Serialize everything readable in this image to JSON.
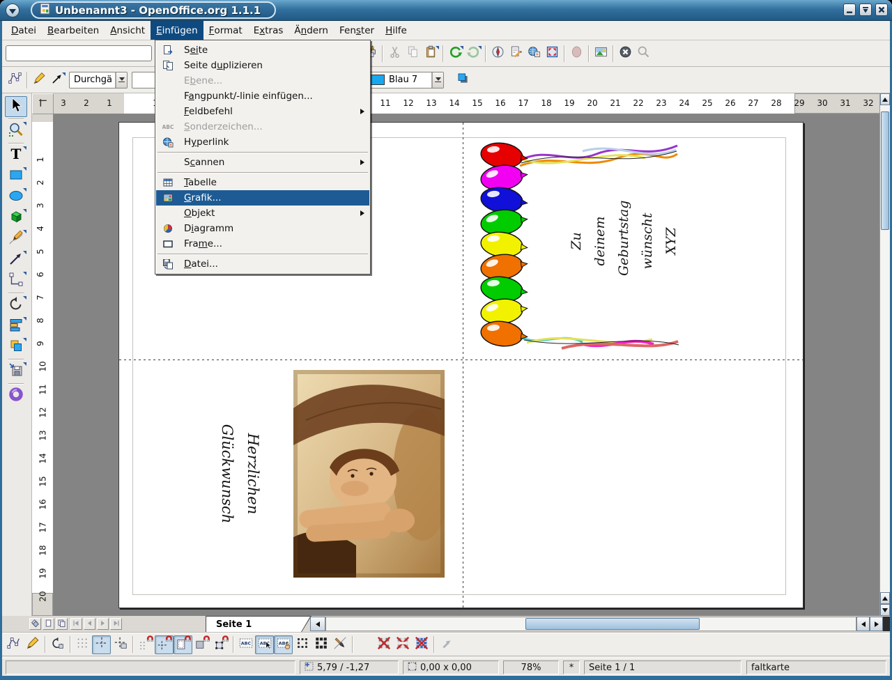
{
  "window": {
    "title": "Unbenannt3 - OpenOffice.org 1.1.1"
  },
  "menubar": {
    "items": [
      {
        "label": "Datei",
        "ul": "D"
      },
      {
        "label": "Bearbeiten",
        "ul": "B"
      },
      {
        "label": "Ansicht",
        "ul": "A"
      },
      {
        "label": "Einfügen",
        "ul": "E",
        "active": true
      },
      {
        "label": "Format",
        "ul": "F"
      },
      {
        "label": "Extras",
        "ul": "x"
      },
      {
        "label": "Ändern",
        "ul": "n"
      },
      {
        "label": "Fenster",
        "ul": "s"
      },
      {
        "label": "Hilfe",
        "ul": "H"
      }
    ]
  },
  "insert_menu": {
    "items": [
      {
        "label": "Seite",
        "ul": "ei",
        "icon": "m_pageins",
        "icon_name": "insert-page-icon"
      },
      {
        "label": "Seite duplizieren",
        "ul": "u",
        "icon": "m_pagedup",
        "icon_name": "duplicate-page-icon"
      },
      {
        "label": "Ebene...",
        "ul": "b",
        "disabled": true
      },
      {
        "label": "Fangpunkt/-linie einfügen...",
        "ul": "a"
      },
      {
        "label": "Feldbefehl",
        "ul": "F",
        "submenu": true
      },
      {
        "label": "Sonderzeichen...",
        "ul": "S",
        "icon": "m_abc",
        "icon_name": "special-character-icon",
        "disabled": true
      },
      {
        "label": "Hyperlink",
        "ul": "y",
        "icon": "m_hyper",
        "icon_name": "hyperlink-icon"
      },
      {
        "sep": true
      },
      {
        "label": "Scannen",
        "ul": "c",
        "submenu": true
      },
      {
        "sep": true
      },
      {
        "label": "Tabelle",
        "ul": "T",
        "icon": "m_table",
        "icon_name": "table-icon"
      },
      {
        "label": "Grafik...",
        "ul": "G",
        "icon": "m_graphic",
        "icon_name": "graphic-icon",
        "highlighted": true
      },
      {
        "label": "Objekt",
        "ul": "O",
        "submenu": true
      },
      {
        "label": "Diagramm",
        "ul": "i",
        "icon": "m_chart",
        "icon_name": "chart-icon"
      },
      {
        "label": "Frame...",
        "ul": "m",
        "icon": "m_frame",
        "icon_name": "frame-icon"
      },
      {
        "sep": true
      },
      {
        "label": "Datei...",
        "ul": "D",
        "icon": "m_file",
        "icon_name": "file-icon"
      }
    ]
  },
  "function_bar": {
    "url_value": "",
    "buttons": [
      {
        "name": "print-file-direct",
        "icon": "printer",
        "icon_name": "printer-icon"
      },
      {
        "sep": true
      },
      {
        "name": "cut",
        "icon": "cut",
        "icon_name": "scissors-icon",
        "disabled": true
      },
      {
        "name": "copy",
        "icon": "copy",
        "icon_name": "copy-icon",
        "disabled": true
      },
      {
        "name": "paste",
        "icon": "paste",
        "icon_name": "clipboard-icon",
        "dd": true
      },
      {
        "sep": true
      },
      {
        "name": "undo",
        "icon": "undo",
        "icon_name": "undo-icon",
        "dd": true
      },
      {
        "name": "restore",
        "icon": "redo",
        "icon_name": "redo-icon",
        "disabled": true,
        "dd": true
      },
      {
        "sep": true
      },
      {
        "name": "navigator",
        "icon": "navigator",
        "icon_name": "navigator-compass-icon"
      },
      {
        "name": "stylist",
        "icon": "stylist",
        "icon_name": "stylist-icon"
      },
      {
        "name": "hyperlink-bar",
        "icon": "hyperbar",
        "icon_name": "globe-document-icon"
      },
      {
        "name": "zoom",
        "icon": "zoomfit",
        "icon_name": "zoom-arrows-icon"
      },
      {
        "sep": true
      },
      {
        "name": "edit-mode",
        "icon": "editmode",
        "icon_name": "oval-icon",
        "disabled": true
      },
      {
        "sep": true
      },
      {
        "name": "gallery",
        "icon": "gallery",
        "icon_name": "gallery-image-icon"
      },
      {
        "sep": true
      },
      {
        "name": "stop-loading",
        "icon": "stop",
        "icon_name": "stop-icon"
      },
      {
        "name": "search",
        "icon": "search",
        "icon_name": "search-icon",
        "disabled": true
      }
    ]
  },
  "object_bar": {
    "line_style": "Durchgä",
    "line_width": "",
    "fill_color_name": "Blau 7",
    "fill_color_hex": "#18a8f0"
  },
  "left_toolbar": {
    "tools": [
      {
        "name": "select",
        "icon": "sel",
        "icon_name": "select-arrow-icon",
        "pressed": true
      },
      {
        "sep": true
      },
      {
        "name": "zoom",
        "icon": "zoomtool",
        "icon_name": "magnifier-icon",
        "dd": true
      },
      {
        "sep": true
      },
      {
        "name": "text",
        "icon": "texttool",
        "icon_name": "text-icon",
        "dd": true
      },
      {
        "name": "rectangle",
        "icon": "recttool",
        "icon_name": "rectangle-icon",
        "dd": true
      },
      {
        "name": "ellipse",
        "icon": "ellipsetool",
        "icon_name": "ellipse-icon",
        "dd": true
      },
      {
        "name": "3d-objects",
        "icon": "cube3d",
        "icon_name": "cube-icon",
        "dd": true
      },
      {
        "name": "curve",
        "icon": "curvetool",
        "icon_name": "pencil-curve-icon",
        "dd": true
      },
      {
        "name": "lines-arrows",
        "icon": "linetool",
        "icon_name": "arrow-line-icon",
        "dd": true
      },
      {
        "name": "connector",
        "icon": "connector",
        "icon_name": "connector-icon",
        "dd": true
      },
      {
        "sep": true
      },
      {
        "name": "rotate",
        "icon": "rotatetool",
        "icon_name": "rotate-icon",
        "dd": true
      },
      {
        "name": "alignment",
        "icon": "aligntool",
        "icon_name": "alignment-icon",
        "dd": true
      },
      {
        "name": "arrange",
        "icon": "arrangetool",
        "icon_name": "arrange-icon",
        "dd": true
      },
      {
        "sep": true
      },
      {
        "name": "insert-object",
        "icon": "insertobj",
        "icon_name": "insert-object-icon",
        "dd": true
      },
      {
        "sep": true
      },
      {
        "name": "effects",
        "icon": "donut",
        "icon_name": "torus-icon"
      }
    ]
  },
  "options_bar": {
    "buttons": [
      {
        "name": "edit-points-mode",
        "icon": "o_editpoints",
        "icon_name": "edit-points-icon"
      },
      {
        "name": "edit-line",
        "icon": "o_pen",
        "icon_name": "pen-icon"
      },
      {
        "sep": true
      },
      {
        "name": "rotation-mode",
        "icon": "o_rotmode",
        "icon_name": "rotation-mode-icon"
      },
      {
        "sep": true
      },
      {
        "name": "show-grid",
        "icon": "o_grid",
        "icon_name": "grid-icon"
      },
      {
        "name": "show-guides",
        "icon": "o_guides",
        "icon_name": "guides-icon",
        "pressed": true
      },
      {
        "name": "guides-to-front",
        "icon": "o_guidesfront",
        "icon_name": "guides-front-icon"
      },
      {
        "sep": true
      },
      {
        "name": "snap-to-grid",
        "icon": "o_snapgrid",
        "icon_name": "snap-grid-icon"
      },
      {
        "name": "snap-to-guides",
        "icon": "o_snapguides",
        "icon_name": "snap-guides-icon",
        "pressed": true
      },
      {
        "name": "snap-to-page-margins",
        "icon": "o_snapmargin",
        "icon_name": "snap-margins-icon",
        "pressed": true
      },
      {
        "name": "snap-to-object-border",
        "icon": "o_snapborder",
        "icon_name": "snap-border-icon"
      },
      {
        "name": "snap-to-object-points",
        "icon": "o_snappoints",
        "icon_name": "snap-points-icon"
      },
      {
        "sep": true
      },
      {
        "name": "quick-edit",
        "icon": "o_abc1",
        "icon_name": "quick-edit-text-icon"
      },
      {
        "name": "select-text-area-only",
        "icon": "o_abc2",
        "icon_name": "select-text-area-icon",
        "pressed": true
      },
      {
        "name": "double-click-to-edit-text",
        "icon": "o_abc3",
        "icon_name": "double-click-text-icon",
        "pressed": true
      },
      {
        "name": "simple-handles",
        "icon": "o_h1",
        "icon_name": "simple-handles-icon"
      },
      {
        "name": "large-handles",
        "icon": "o_h2",
        "icon_name": "large-handles-icon"
      },
      {
        "name": "create-with-attributes",
        "icon": "o_brush",
        "icon_name": "brush-icon"
      },
      {
        "sep": true
      },
      {
        "name": "picture-placeholder",
        "icon": "o_ph1",
        "icon_name": "picture-placeholder-icon"
      },
      {
        "name": "contour-placeholder",
        "icon": "o_ph2",
        "icon_name": "contour-placeholder-icon"
      },
      {
        "name": "text-placeholder",
        "icon": "o_ph3",
        "icon_name": "text-placeholder-icon"
      },
      {
        "name": "line-placeholder",
        "icon": "o_ph4",
        "icon_name": "line-placeholder-icon"
      },
      {
        "sep": true
      },
      {
        "name": "exit-all-groups",
        "icon": "o_exit",
        "icon_name": "exit-group-icon",
        "disabled": true
      }
    ]
  },
  "rulers": {
    "h_left": [
      3,
      2,
      1
    ],
    "h_start": 1,
    "h_end": 32,
    "v_start": 1,
    "v_end": 20
  },
  "page_tab": {
    "label": "Seite 1"
  },
  "status_bar": {
    "fields": [
      {
        "name": "info",
        "value": ""
      },
      {
        "name": "cursor-position",
        "value": "5,79 / -1,27",
        "icon": "posicon",
        "icon_name": "position-icon"
      },
      {
        "name": "object-size",
        "value": "0,00 x 0,00",
        "icon": "sizeicon",
        "icon_name": "size-icon"
      },
      {
        "name": "zoom-level",
        "value": "78%"
      },
      {
        "name": "modified-indicator",
        "value": "*"
      },
      {
        "name": "page-indicator",
        "value": "Seite 1 / 1"
      },
      {
        "name": "page-style",
        "value": "faltkarte"
      }
    ]
  },
  "card": {
    "front_lines": [
      "Zu",
      "deinem",
      "Geburtstag",
      "wünscht",
      "XYZ"
    ],
    "inside_lines": [
      "Herzlichen",
      "Glückwunsch"
    ],
    "balloon_colors": [
      "#e60000",
      "#f200f2",
      "#1010d8",
      "#00cc00",
      "#f2f200",
      "#f07000",
      "#00cc00",
      "#f2f200",
      "#f07000"
    ]
  }
}
